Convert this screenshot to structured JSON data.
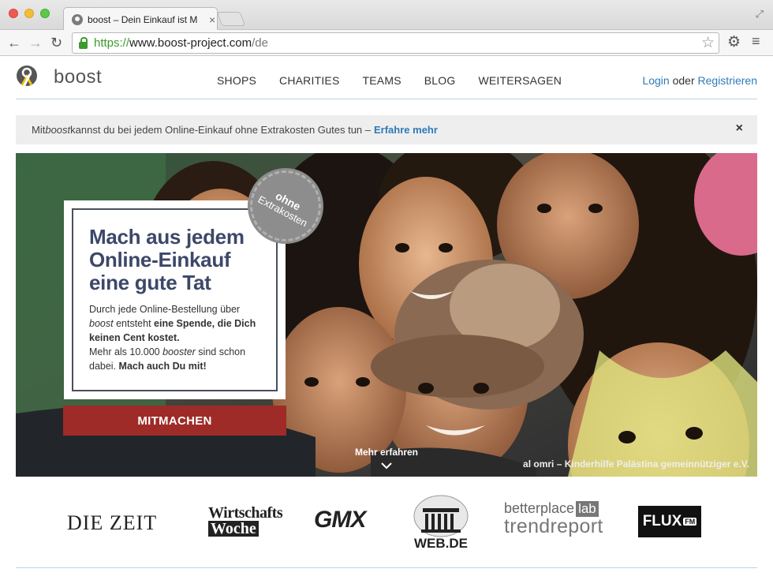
{
  "browser": {
    "tab_title": "boost – Dein Einkauf ist M",
    "tab_close": "×",
    "url_scheme": "https://",
    "url_host": "www.boost-project.com",
    "url_path": "/de"
  },
  "site": {
    "logo_text": "boost",
    "nav": [
      "SHOPS",
      "CHARITIES",
      "TEAMS",
      "BLOG",
      "WEITERSAGEN"
    ],
    "login": "Login",
    "oder": "oder",
    "register": "Registrieren"
  },
  "info_bar": {
    "text_before": "Mit ",
    "brand": "boost",
    "text_after": " kannst du bei jedem Online-Einkauf ohne Extrakosten Gutes tun –",
    "link": "Erfahre mehr",
    "close": "×"
  },
  "hero": {
    "title_line1": "Mach aus jedem",
    "title_line2": "Online-Einkauf",
    "title_line3": "eine gute Tat",
    "p1_a": "Durch jede Online-Bestellung über ",
    "p1_brand": "boost",
    "p1_b": " entsteht ",
    "p1_bold": "eine Spende, die Dich keinen Cent kostet.",
    "p2_a": "Mehr als 10.000 ",
    "p2_em": "booster",
    "p2_b": " sind schon dabei. ",
    "p2_bold": "Mach auch Du mit!",
    "badge_line1": "ohne",
    "badge_line2": "Extrakosten",
    "cta": "MITMACHEN",
    "more": "Mehr erfahren",
    "credit": "al omri – Kinderhilfe Palästina gemeinnütziger e.V."
  },
  "press": {
    "zeit": "DIE ZEIT",
    "wiwo_line1": "Wirtschafts",
    "wiwo_line2": "Woche",
    "gmx": "GMX",
    "webde": "WEB.DE",
    "bp_line1": "betterplace",
    "bp_lab": "lab",
    "bp_line2": "trendreport",
    "flux": "FLUX",
    "flux_fm": "FM"
  },
  "colors": {
    "accent_blue": "#2f7ab7",
    "cta_red": "#9e2b27",
    "title_navy": "#3d4868"
  }
}
